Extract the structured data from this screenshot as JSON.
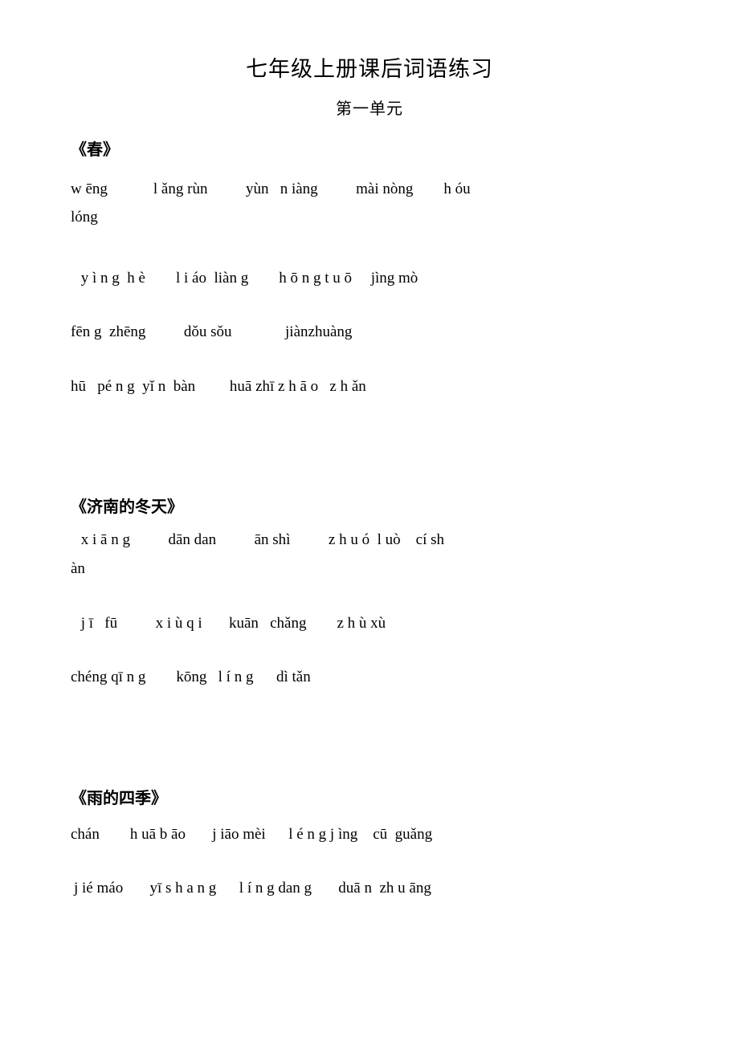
{
  "document": {
    "title": "七年级上册课后词语练习",
    "subtitle": "第一单元",
    "text_color": "#000000",
    "background_color": "#ffffff"
  },
  "sections": [
    {
      "title": "《春》",
      "lines": [
        "w ēng            l ǎng rùn          yùn   n iàng          mài nòng        h óu",
        "lóng",
        " y ì n g  h è        l i áo  liàn g        h ō n g t u ō     jìng mò",
        "fēn g  zhēng          dǒu sǒu              jiànzhuàng",
        "hū   pé n g  yǐ n  bàn         huā zhī z h ā o   z h ǎn"
      ]
    },
    {
      "title": "《济南的冬天》",
      "lines": [
        " x i ā n g          dān dan          ān shì          z h u ó  l uò    cí sh",
        "àn",
        " j ī   fū          x i ù q i       kuān   chǎng        z h ù xù",
        "chéng qī n g        kōng   l í n g      dì tǎn"
      ]
    },
    {
      "title": "《雨的四季》",
      "lines": [
        "chán        h uā b āo       j iāo mèi      l é n g j ìng    cū  guǎng",
        "j ié máo       yī s h a n g      l í n g dan g       duā n  zh u āng"
      ]
    }
  ]
}
